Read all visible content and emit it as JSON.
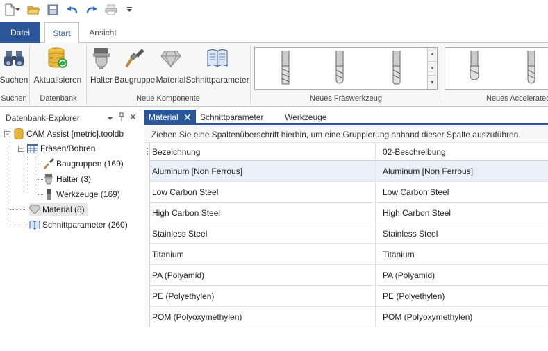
{
  "qat": {
    "items": [
      "new-icon",
      "open-icon",
      "save-icon",
      "undo-icon",
      "redo-icon",
      "print-icon",
      "customize-icon"
    ]
  },
  "ribbon_tabs": {
    "file": "Datei",
    "start": "Start",
    "view": "Ansicht"
  },
  "ribbon": {
    "search_label": "Suchen",
    "refresh_label": "Aktualisieren",
    "holder_label": "Halter",
    "assembly_label": "Baugruppe",
    "material_label": "Material",
    "cutparams_label": "Schnittparameter",
    "groups": {
      "search": "Suchen",
      "database": "Datenbank",
      "new_component": "Neue Komponente",
      "new_mill_tool": "Neues Fräswerkzeug",
      "new_accelerated": "Neues Accelerated"
    }
  },
  "explorer": {
    "title": "Datenbank-Explorer",
    "pin": "ᵖ",
    "root": "CAM Assist [metric].tooldb",
    "node_mill": "Fräsen/Bohren",
    "node_assemblies": "Baugruppen (169)",
    "node_holders": "Halter (3)",
    "node_tools": "Werkzeuge (169)",
    "node_material": "Material (8)",
    "node_cutparams": "Schnittparameter (260)"
  },
  "doc_tabs": {
    "material": "Material",
    "cutparams": "Schnittparameter",
    "tools": "Werkzeuge"
  },
  "group_panel_text": "Ziehen Sie eine Spaltenüberschrift hierhin, um eine Gruppierung anhand dieser Spalte auszuführen.",
  "grid": {
    "columns": [
      "Bezeichnung",
      "02-Beschreibung"
    ],
    "rows": [
      [
        "Aluminum [Non Ferrous]",
        "Aluminum [Non Ferrous]"
      ],
      [
        "Low Carbon Steel",
        "Low Carbon Steel"
      ],
      [
        "High Carbon Steel",
        "High Carbon Steel"
      ],
      [
        "Stainless Steel",
        "Stainless Steel"
      ],
      [
        "Titanium",
        "Titanium"
      ],
      [
        "PA (Polyamid)",
        "PA (Polyamid)"
      ],
      [
        "PE (Polyethylen)",
        "PE (Polyethylen)"
      ],
      [
        "POM (Polyoxymethylen)",
        "POM (Polyoxymethylen)"
      ]
    ]
  },
  "colors": {
    "accent": "#2b579a",
    "selected_row": "#e9f0f9"
  }
}
